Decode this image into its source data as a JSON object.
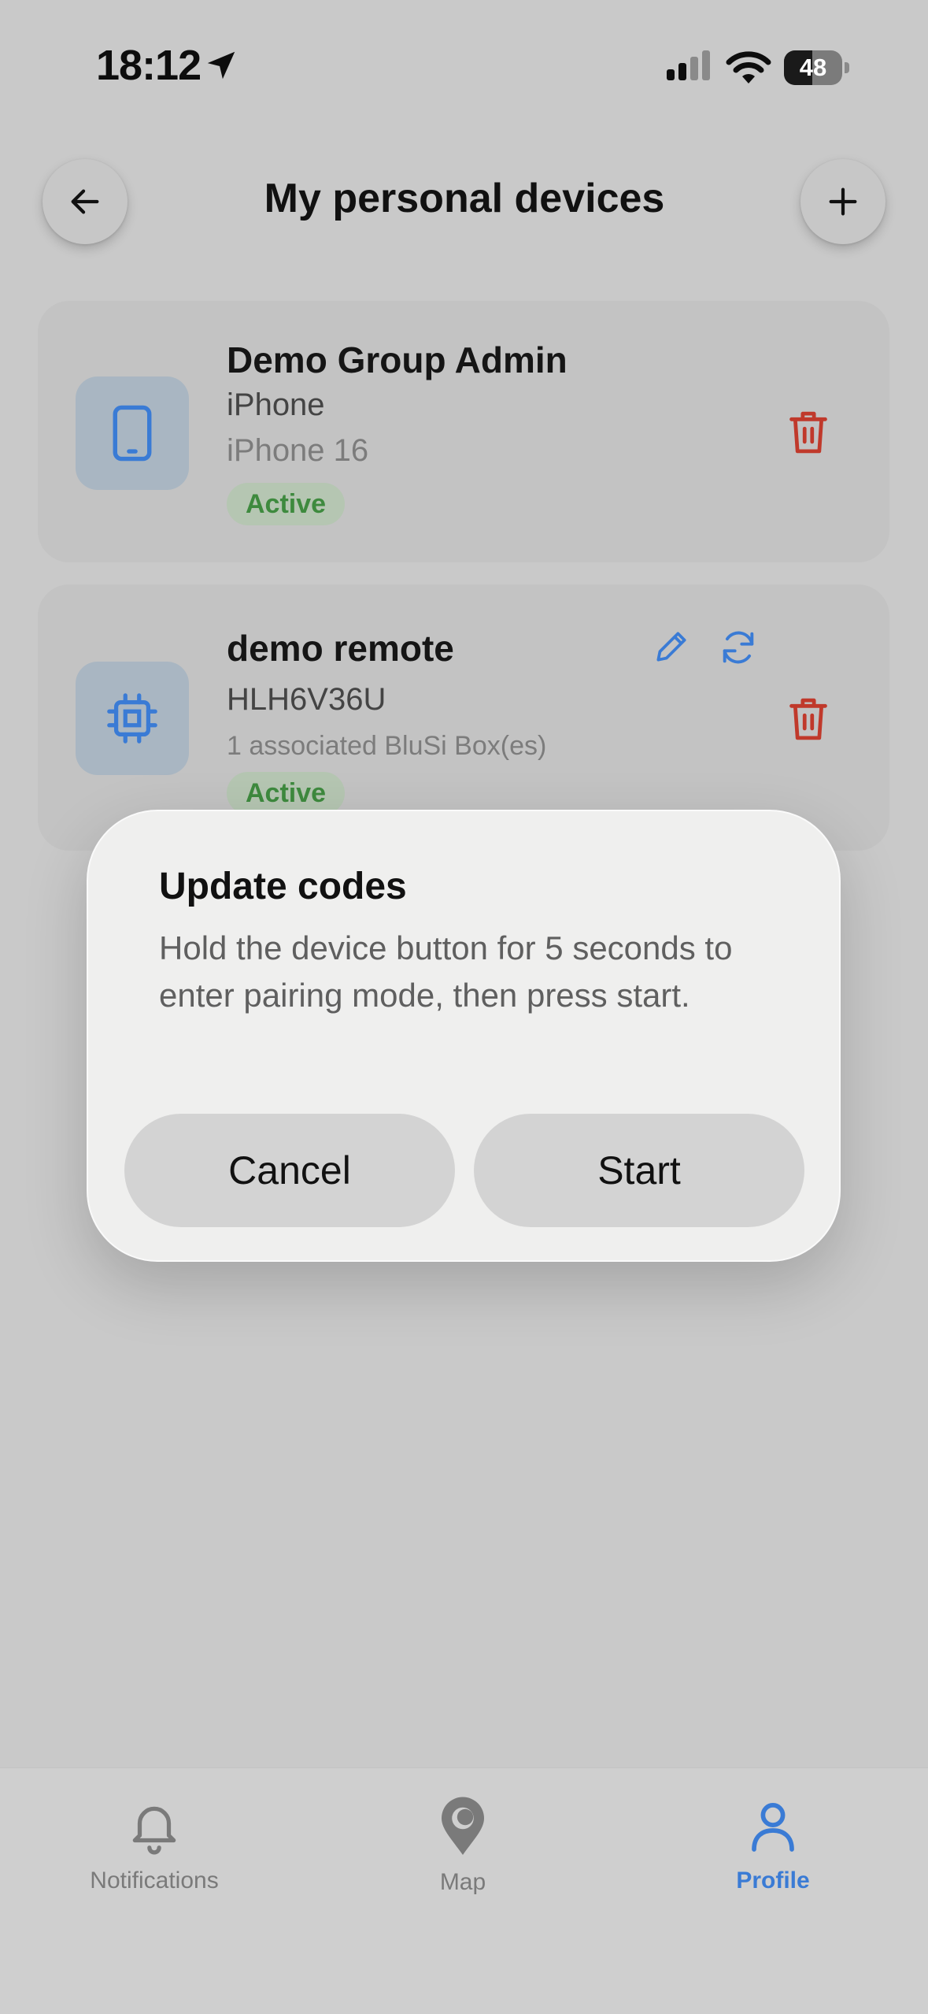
{
  "status_bar": {
    "time": "18:12",
    "battery_percent": 48,
    "icons": [
      "location-arrow-icon",
      "cellular-signal-icon",
      "wifi-icon",
      "battery-icon"
    ]
  },
  "header": {
    "title": "My personal devices",
    "back_icon": "arrow-left-icon",
    "add_icon": "plus-icon"
  },
  "devices": [
    {
      "name": "Demo Group Admin",
      "type": "iPhone",
      "model": "iPhone 16",
      "status": "Active",
      "icon": "smartphone-icon",
      "actions": [
        "trash-icon"
      ]
    },
    {
      "name": "demo remote",
      "type": "HLH6V36U",
      "model": "1 associated BluSi Box(es)",
      "status": "Active",
      "icon": "chip-icon",
      "actions": [
        "pencil-icon",
        "refresh-icon",
        "trash-icon"
      ]
    }
  ],
  "dialog": {
    "title": "Update codes",
    "body": "Hold the device button for 5 seconds to enter pairing mode, then press start.",
    "cancel_label": "Cancel",
    "start_label": "Start"
  },
  "tabs": [
    {
      "label": "Notifications",
      "icon": "bell-icon",
      "active": false
    },
    {
      "label": "Map",
      "icon": "map-pin-icon",
      "active": false
    },
    {
      "label": "Profile",
      "icon": "person-icon",
      "active": true
    }
  ],
  "colors": {
    "accent": "#3a7bd5",
    "danger": "#c0392b",
    "active_badge_text": "#3e8a3e",
    "inactive_tab": "#7a7a7a"
  }
}
